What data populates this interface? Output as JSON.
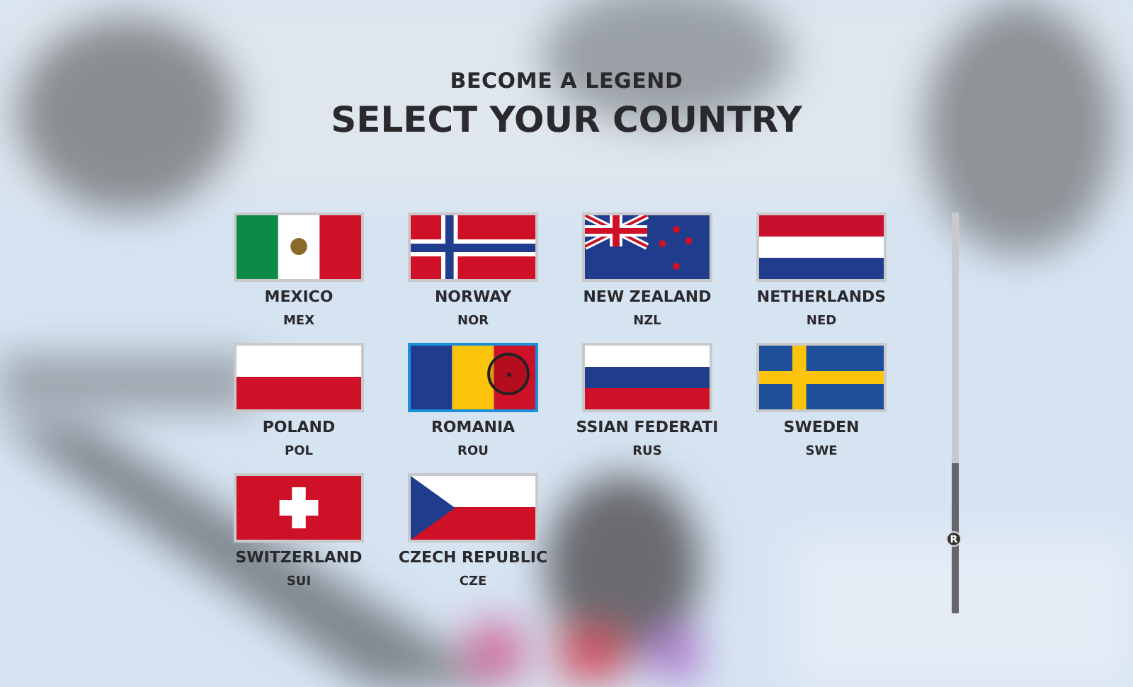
{
  "header": {
    "subtitle": "BECOME A LEGEND",
    "title": "SELECT YOUR COUNTRY"
  },
  "countries": [
    {
      "kind": "mexico",
      "name": "MEXICO",
      "code": "MEX",
      "selected": false
    },
    {
      "kind": "norway",
      "name": "NORWAY",
      "code": "NOR",
      "selected": false
    },
    {
      "kind": "newzealand",
      "name": "NEW ZEALAND",
      "code": "NZL",
      "selected": false
    },
    {
      "kind": "netherlands",
      "name": "NETHERLANDS",
      "code": "NED",
      "selected": false
    },
    {
      "kind": "poland",
      "name": "POLAND",
      "code": "POL",
      "selected": false
    },
    {
      "kind": "romania",
      "name": "ROMANIA",
      "code": "ROU",
      "selected": true
    },
    {
      "kind": "russia",
      "name": "SSIAN FEDERATI",
      "code": "RUS",
      "selected": false
    },
    {
      "kind": "sweden",
      "name": "SWEDEN",
      "code": "SWE",
      "selected": false
    },
    {
      "kind": "switzerland",
      "name": "SWITZERLAND",
      "code": "SUI",
      "selected": false
    },
    {
      "kind": "czech",
      "name": "CZECH REPUBLIC",
      "code": "CZE",
      "selected": false
    }
  ],
  "scroll_hint": "R"
}
